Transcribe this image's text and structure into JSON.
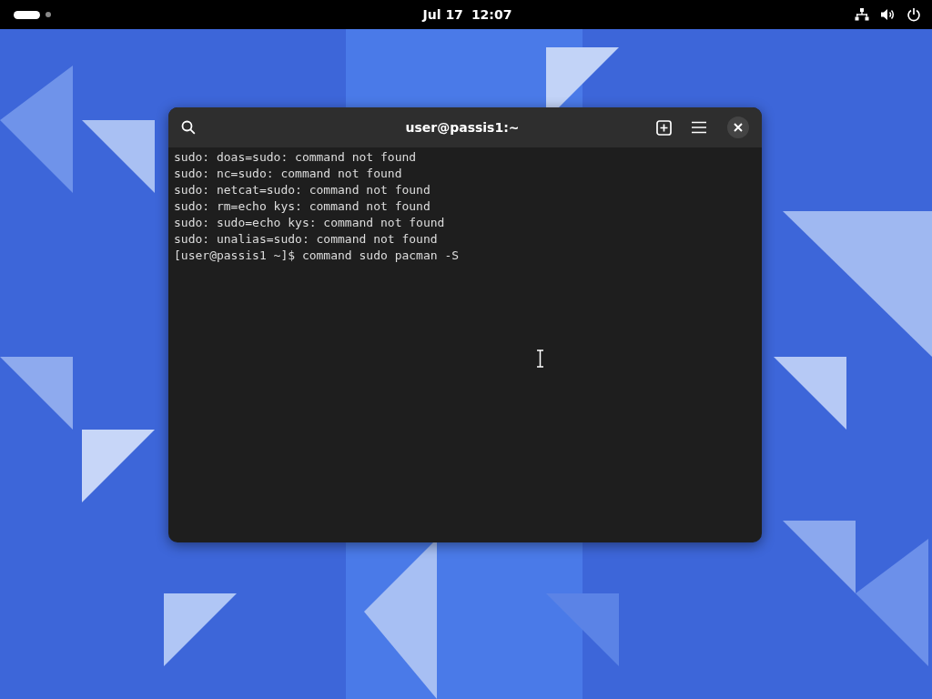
{
  "top_bar": {
    "workspaces": [
      {
        "selected": true
      },
      {
        "selected": false
      }
    ],
    "date": "Jul 17",
    "time": "12:07"
  },
  "terminal": {
    "title": "user@passis1:~",
    "lines": [
      "sudo: doas=sudo: command not found",
      "sudo: nc=sudo: command not found",
      "sudo: netcat=sudo: command not found",
      "sudo: rm=echo kys: command not found",
      "sudo: sudo=echo kys: command not found",
      "sudo: unalias=sudo: command not found",
      "[user@passis1 ~]$ command sudo pacman -S"
    ]
  }
}
